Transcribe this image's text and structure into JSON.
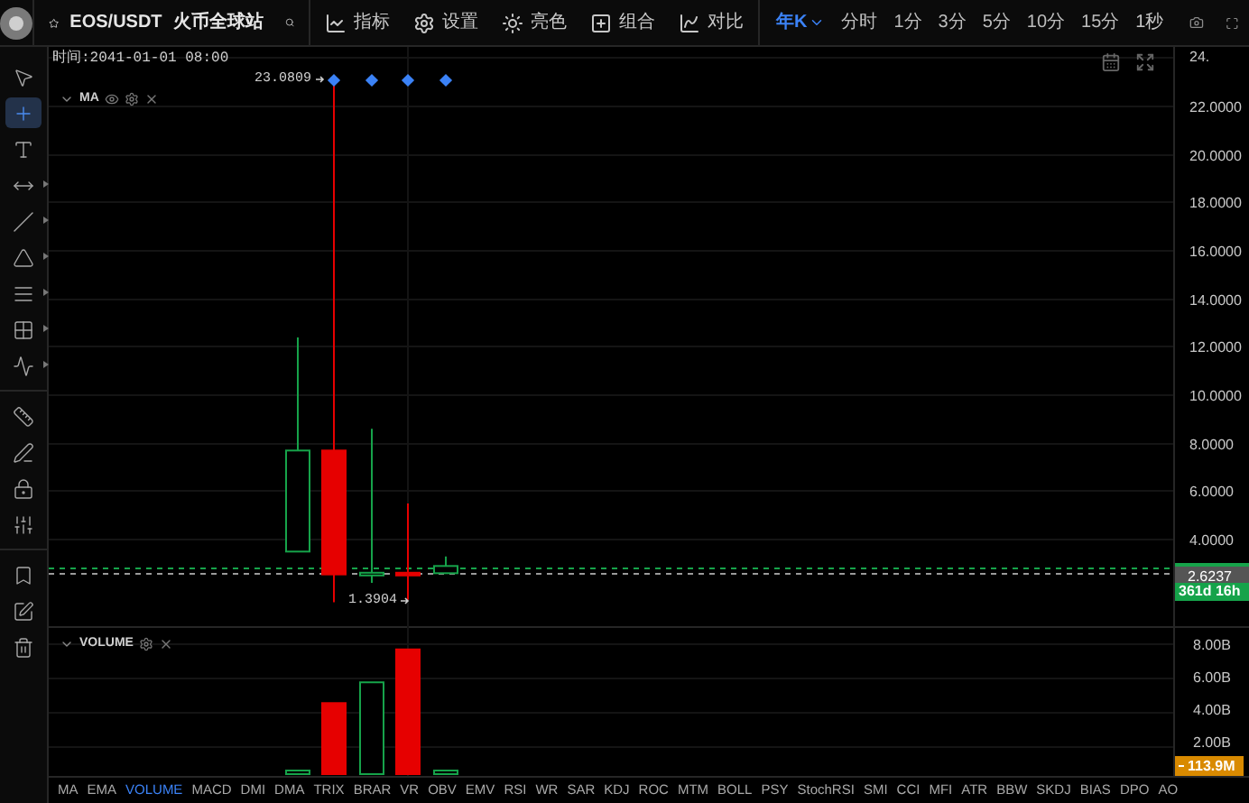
{
  "header": {
    "pair": "EOS/USDT",
    "exchange": "火币全球站"
  },
  "toolbar": [
    {
      "kind": "indicator",
      "label": "指标"
    },
    {
      "kind": "settings",
      "label": "设置"
    },
    {
      "kind": "theme",
      "label": "亮色"
    },
    {
      "kind": "layout",
      "label": "组合"
    },
    {
      "kind": "compare",
      "label": "对比"
    }
  ],
  "intervals": [
    {
      "label": "年K",
      "selected": true
    },
    {
      "label": "分时",
      "selected": false
    },
    {
      "label": "1分",
      "selected": false
    },
    {
      "label": "3分",
      "selected": false
    },
    {
      "label": "5分",
      "selected": false
    },
    {
      "label": "10分",
      "selected": false
    },
    {
      "label": "15分",
      "selected": false
    }
  ],
  "seconds": "1秒",
  "tools": [
    {
      "kind": "cursor",
      "selected": false
    },
    {
      "kind": "crosshair",
      "selected": true
    },
    {
      "kind": "text",
      "selected": false
    },
    {
      "kind": "ray",
      "selected": false
    },
    {
      "kind": "channel",
      "selected": false
    },
    {
      "kind": "triangle",
      "selected": false
    },
    {
      "kind": "fib",
      "selected": false
    },
    {
      "kind": "grid",
      "selected": false
    },
    {
      "kind": "wave",
      "selected": false
    },
    {
      "kind": "ruler",
      "selected": false
    },
    {
      "kind": "pen",
      "selected": false
    },
    {
      "kind": "lock",
      "selected": false
    },
    {
      "kind": "magnet",
      "selected": false
    },
    {
      "kind": "layers",
      "selected": false
    },
    {
      "kind": "edit",
      "selected": false
    },
    {
      "kind": "trash",
      "selected": false
    }
  ],
  "chart": {
    "time_label": "时间:2041-01-01 08:00",
    "legend": "MA",
    "high_label": "23.0809",
    "low_label": "1.3904",
    "price_ticks": [
      "24.",
      "22.0000",
      "20.0000",
      "18.0000",
      "16.0000",
      "14.0000",
      "12.0000",
      "10.0000",
      "8.0000",
      "6.0000",
      "4.0000"
    ],
    "last_price": "2.6237",
    "countdown": "361d 16h"
  },
  "volume": {
    "legend": "VOLUME",
    "ticks": [
      "8.00B",
      "6.00B",
      "4.00B",
      "2.00B"
    ],
    "last_volume": "113.9M"
  },
  "indicator_tabs": [
    {
      "label": "MA",
      "selected": false
    },
    {
      "label": "EMA",
      "selected": false
    },
    {
      "label": "VOLUME",
      "selected": true
    },
    {
      "label": "MACD",
      "selected": false
    },
    {
      "label": "DMI",
      "selected": false
    },
    {
      "label": "DMA",
      "selected": false
    },
    {
      "label": "TRIX",
      "selected": false
    },
    {
      "label": "BRAR",
      "selected": false
    },
    {
      "label": "VR",
      "selected": false
    },
    {
      "label": "OBV",
      "selected": false
    },
    {
      "label": "EMV",
      "selected": false
    },
    {
      "label": "RSI",
      "selected": false
    },
    {
      "label": "WR",
      "selected": false
    },
    {
      "label": "SAR",
      "selected": false
    },
    {
      "label": "KDJ",
      "selected": false
    },
    {
      "label": "ROC",
      "selected": false
    },
    {
      "label": "MTM",
      "selected": false
    },
    {
      "label": "BOLL",
      "selected": false
    },
    {
      "label": "PSY",
      "selected": false
    },
    {
      "label": "StochRSI",
      "selected": false
    },
    {
      "label": "SMI",
      "selected": false
    },
    {
      "label": "CCI",
      "selected": false
    },
    {
      "label": "MFI",
      "selected": false
    },
    {
      "label": "ATR",
      "selected": false
    },
    {
      "label": "BBW",
      "selected": false
    },
    {
      "label": "SKDJ",
      "selected": false
    },
    {
      "label": "BIAS",
      "selected": false
    },
    {
      "label": "DPO",
      "selected": false
    },
    {
      "label": "AO",
      "selected": false
    }
  ]
}
